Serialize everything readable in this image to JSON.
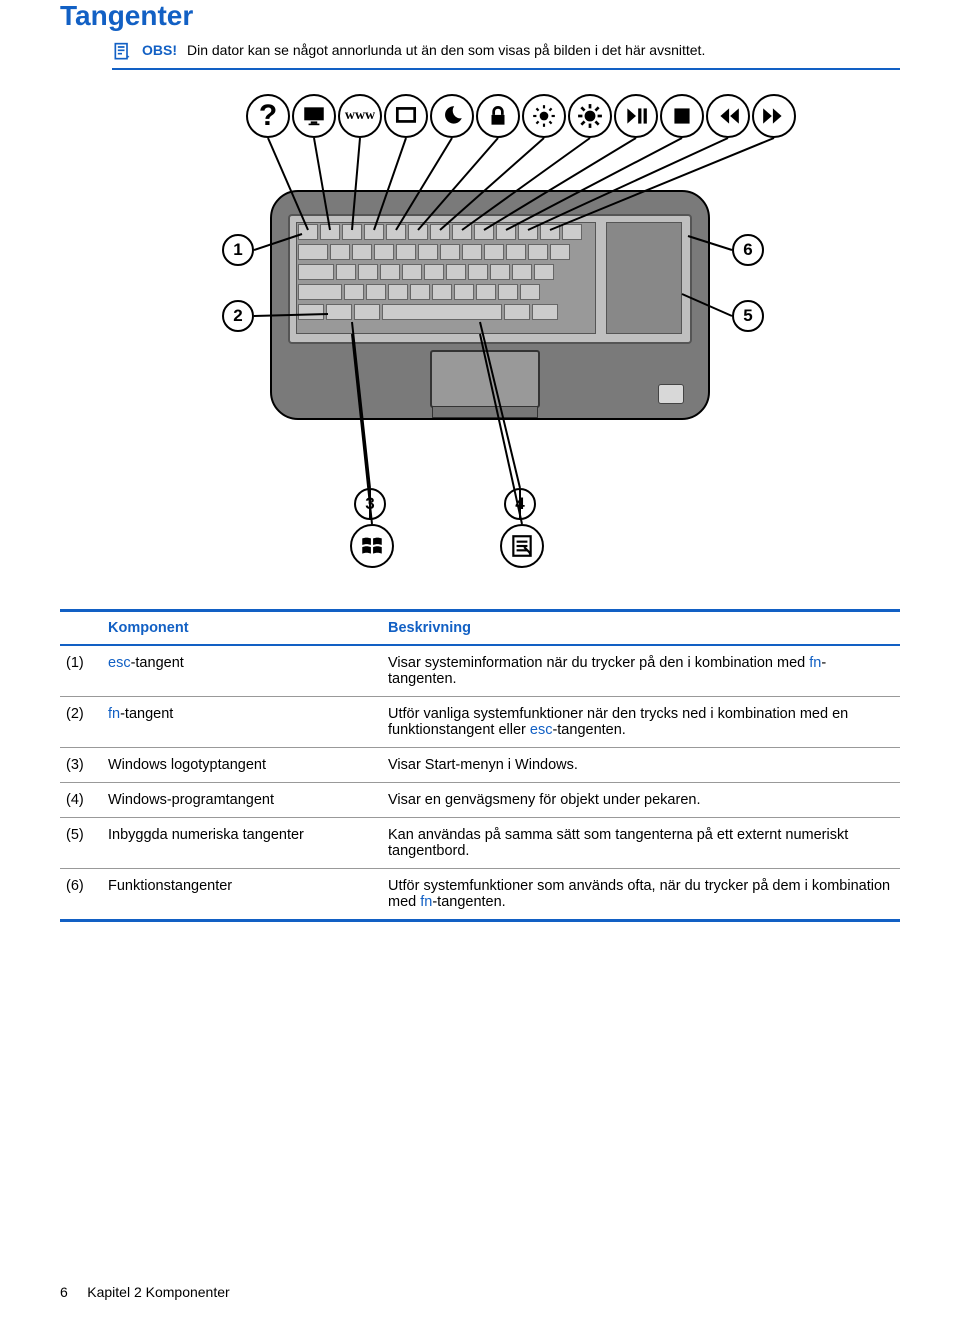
{
  "title": "Tangenter",
  "note": {
    "label": "OBS!",
    "text": "Din dator kan se något annorlunda ut än den som visas på bilden i det här avsnittet."
  },
  "diagram": {
    "top_icons": [
      "help",
      "monitor",
      "www",
      "rect",
      "moon",
      "lock",
      "brightness-down",
      "brightness-up",
      "play-pause",
      "stop",
      "prev",
      "next"
    ],
    "labels": {
      "1": "1",
      "2": "2",
      "3": "3",
      "4": "4",
      "5": "5",
      "6": "6"
    }
  },
  "table": {
    "headers": {
      "component": "Komponent",
      "description": "Beskrivning"
    },
    "rows": [
      {
        "n": "(1)",
        "name_pre": "",
        "name_link": "esc",
        "name_post": "-tangent",
        "desc": [
          "Visar systeminformation när du trycker på den i kombination med ",
          "fn",
          "-tangenten."
        ]
      },
      {
        "n": "(2)",
        "name_pre": "",
        "name_link": "fn",
        "name_post": "-tangent",
        "desc": [
          "Utför vanliga systemfunktioner när den trycks ned i kombination med en funktionstangent eller ",
          "esc",
          "-tangenten."
        ]
      },
      {
        "n": "(3)",
        "name_pre": "Windows logotyptangent",
        "name_link": "",
        "name_post": "",
        "desc": [
          "Visar Start-menyn i Windows.",
          "",
          ""
        ]
      },
      {
        "n": "(4)",
        "name_pre": "Windows-programtangent",
        "name_link": "",
        "name_post": "",
        "desc": [
          "Visar en genvägsmeny för objekt under pekaren.",
          "",
          ""
        ]
      },
      {
        "n": "(5)",
        "name_pre": "Inbyggda numeriska tangenter",
        "name_link": "",
        "name_post": "",
        "desc": [
          "Kan användas på samma sätt som tangenterna på ett externt numeriskt tangentbord.",
          "",
          ""
        ]
      },
      {
        "n": "(6)",
        "name_pre": "Funktionstangenter",
        "name_link": "",
        "name_post": "",
        "desc": [
          "Utför systemfunktioner som används ofta, när du trycker på dem i kombination med ",
          "fn",
          "-tangenten."
        ]
      }
    ]
  },
  "footer": {
    "page": "6",
    "chapter": "Kapitel 2   Komponenter"
  }
}
